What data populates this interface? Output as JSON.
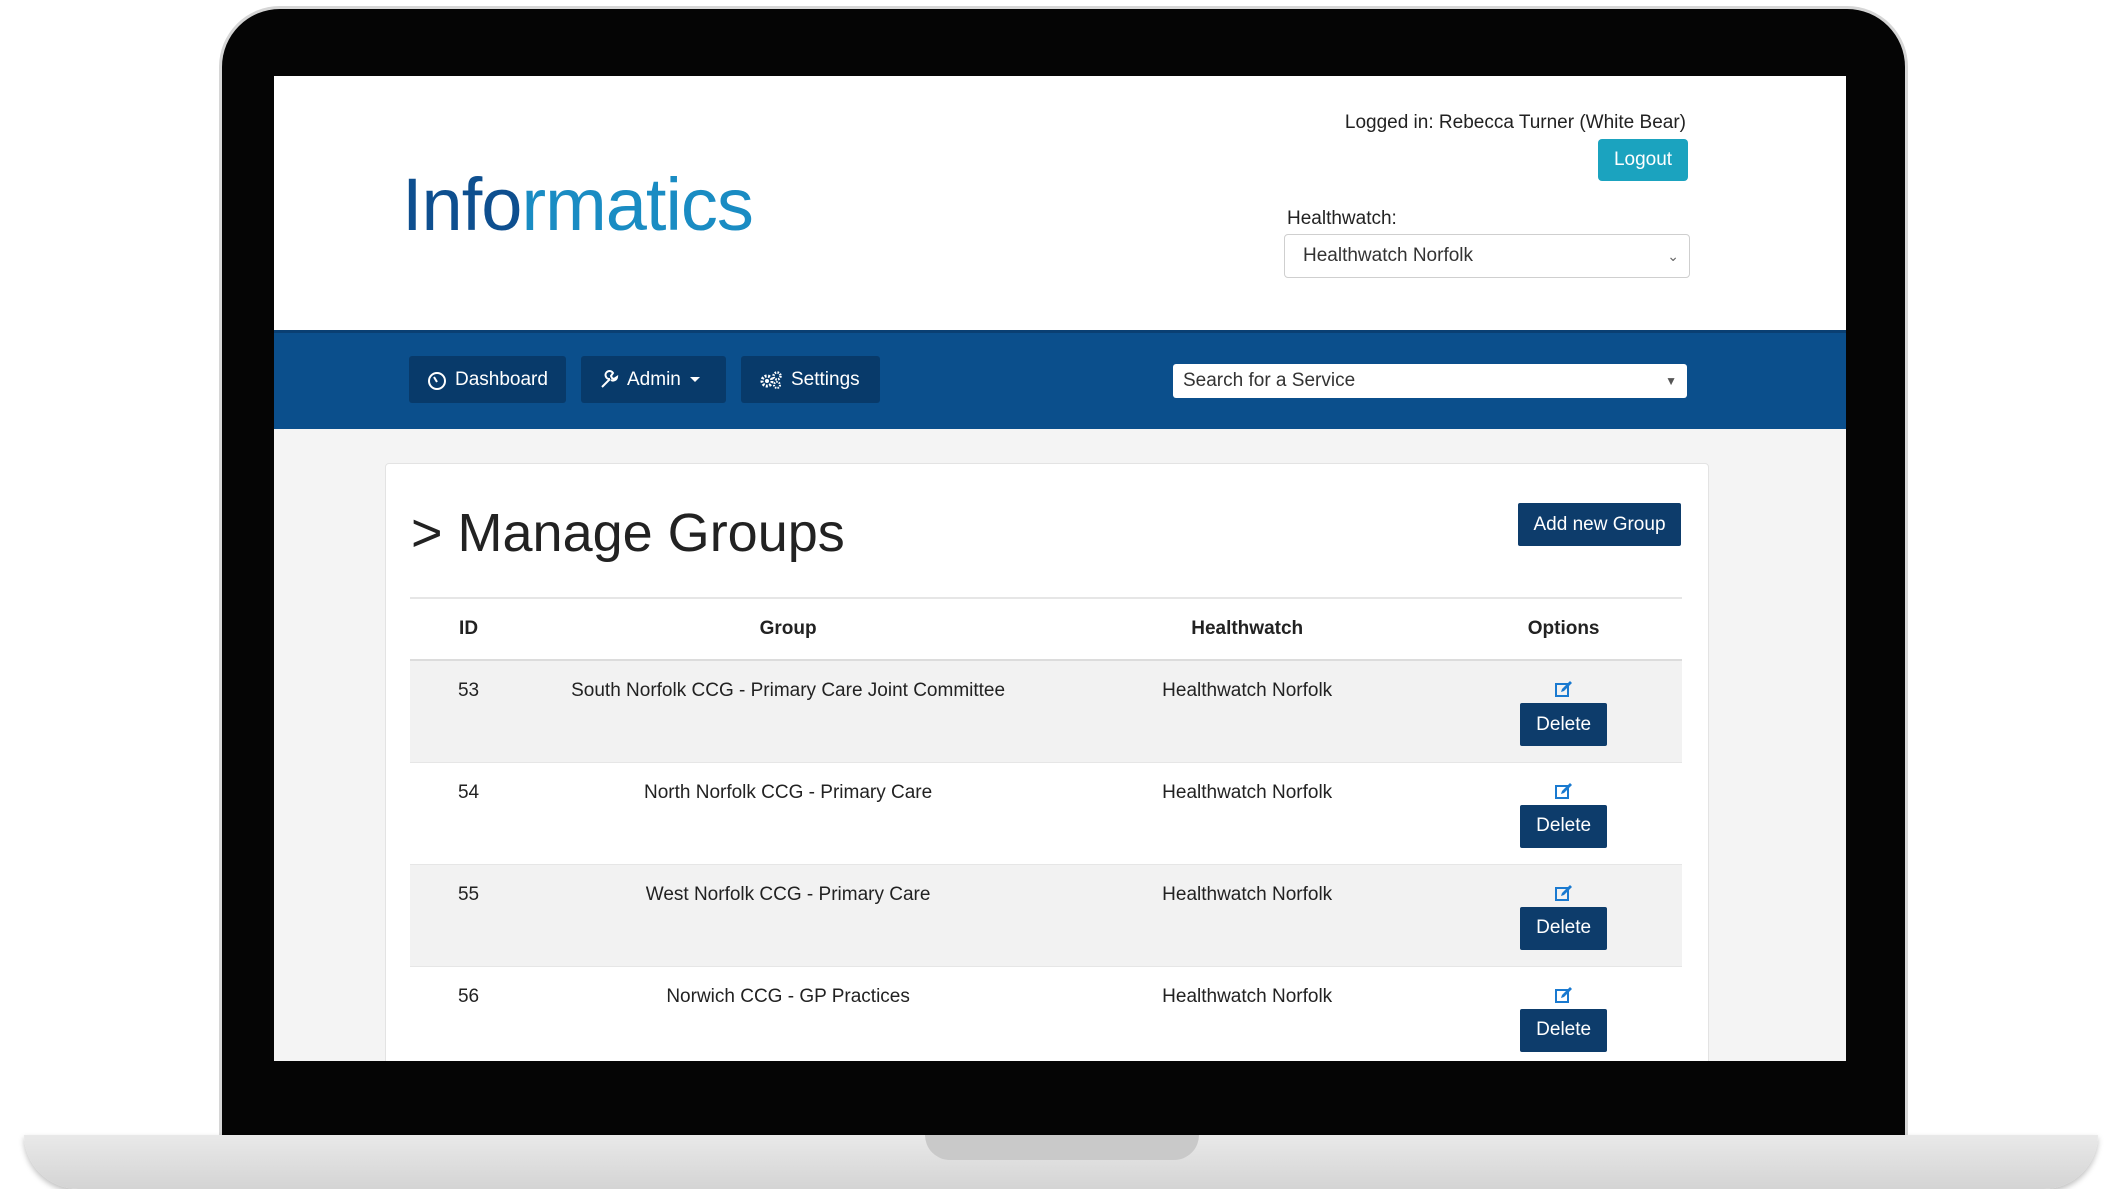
{
  "header": {
    "logo_part1": "Info",
    "logo_part2": "rmatics",
    "logged_in_text": "Logged in: Rebecca Turner (White Bear)",
    "logout_label": "Logout",
    "healthwatch_label": "Healthwatch:",
    "healthwatch_selected": "Healthwatch Norfolk"
  },
  "nav": {
    "dashboard_label": "Dashboard",
    "admin_label": "Admin",
    "settings_label": "Settings",
    "search_placeholder": "Search for a Service"
  },
  "main": {
    "title": "> Manage Groups",
    "add_button_label": "Add new Group",
    "columns": [
      "ID",
      "Group",
      "Healthwatch",
      "Options"
    ],
    "rows": [
      {
        "id": "53",
        "group": "South Norfolk CCG - Primary Care Joint Committee",
        "healthwatch": "Healthwatch Norfolk",
        "delete_label": "Delete"
      },
      {
        "id": "54",
        "group": "North Norfolk CCG - Primary Care",
        "healthwatch": "Healthwatch Norfolk",
        "delete_label": "Delete"
      },
      {
        "id": "55",
        "group": "West Norfolk CCG - Primary Care",
        "healthwatch": "Healthwatch Norfolk",
        "delete_label": "Delete"
      },
      {
        "id": "56",
        "group": "Norwich CCG - GP Practices",
        "healthwatch": "Healthwatch Norfolk",
        "delete_label": "Delete"
      }
    ]
  },
  "colors": {
    "navbar": "#0b4f8c",
    "primary_button": "#0d3c6b",
    "logout_button": "#1ba3bf",
    "logo_dark": "#0e4f8f",
    "logo_light": "#1a8cc3"
  },
  "icons": [
    "dashboard-icon",
    "wrench-icon",
    "caret-down-icon",
    "gears-icon",
    "edit-icon",
    "chevron-down-icon"
  ]
}
